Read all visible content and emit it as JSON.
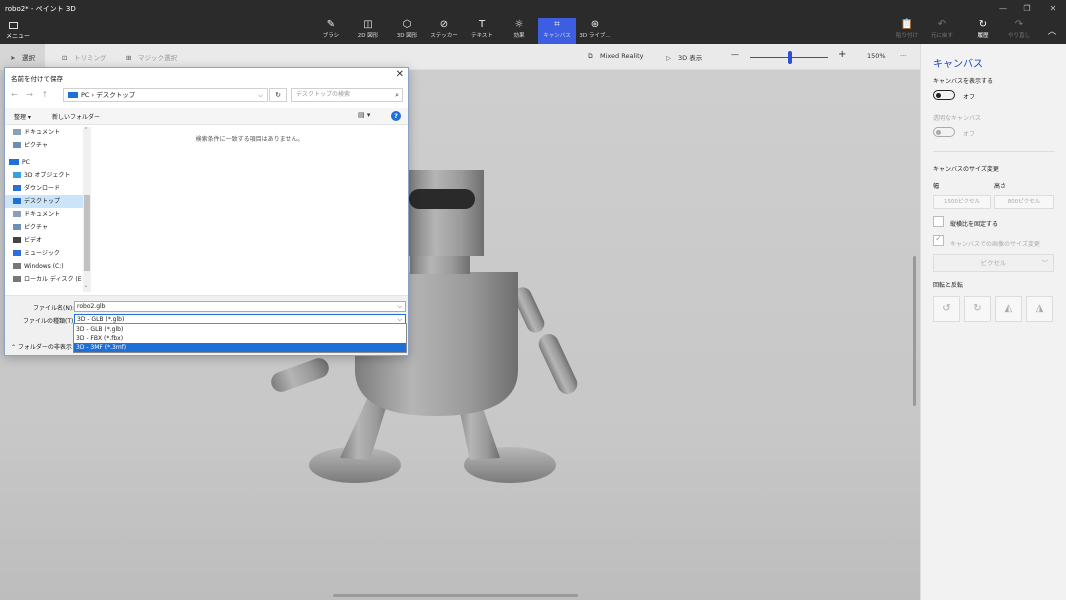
{
  "window": {
    "title": "robo2* - ペイント 3D",
    "controls": [
      "—",
      "❐",
      "✕"
    ]
  },
  "ribbon": {
    "menu_label": "メニュー",
    "tools": [
      {
        "label": "ブラシ",
        "icon": "brush-icon",
        "glyph": "✎"
      },
      {
        "label": "2D 図形",
        "icon": "2d-shapes-icon",
        "glyph": "◫"
      },
      {
        "label": "3D 図形",
        "icon": "3d-shapes-icon",
        "glyph": "⬡"
      },
      {
        "label": "ステッカー",
        "icon": "stickers-icon",
        "glyph": "⊘"
      },
      {
        "label": "テキスト",
        "icon": "text-icon",
        "glyph": "T"
      },
      {
        "label": "効果",
        "icon": "effects-icon",
        "glyph": "☼"
      },
      {
        "label": "キャンバス",
        "icon": "canvas-icon",
        "glyph": "⌗"
      },
      {
        "label": "3D ライブ...",
        "icon": "3d-library-icon",
        "glyph": "⊛"
      }
    ],
    "right_tools": [
      {
        "label": "貼り付け",
        "icon": "paste-icon",
        "glyph": "📋"
      },
      {
        "label": "元に戻す",
        "icon": "undo-icon",
        "glyph": "↶"
      },
      {
        "label": "履歴",
        "icon": "history-icon",
        "glyph": "↻"
      },
      {
        "label": "やり直し",
        "icon": "redo-icon",
        "glyph": "↷"
      }
    ],
    "collapse_glyph": "︿"
  },
  "toolbar": {
    "select_label": "選択",
    "crop_label": "トリミング",
    "magic_select_label": "マジック選択",
    "mixed_reality_label": "Mixed Reality",
    "view3d_label": "3D 表示",
    "zoom_minus": "—",
    "zoom_plus": "+",
    "zoom_level": "150%",
    "more": "···"
  },
  "panel": {
    "title": "キャンバス",
    "show_canvas_label": "キャンバスを表示する",
    "show_canvas_state": "オフ",
    "transparent_label": "透明なキャンバス",
    "transparent_state": "オフ",
    "resize_label": "キャンバスのサイズ変更",
    "width_label": "幅",
    "height_label": "高さ",
    "width_value": "1500ピクセル",
    "height_value": "800ピクセル",
    "lock_ratio_label": "縦横比を固定する",
    "resize_image_label": "キャンバスでの画像のサイズ変更",
    "unit_select": "ピクセル",
    "rotate_label": "回転と反転"
  },
  "dialog": {
    "title": "名前を付けて保存",
    "close": "✕",
    "nav_arrows": "← → ↑",
    "address": "PC  ›  デスクトップ",
    "refresh": "↻",
    "search_placeholder": "デスクトップの検索",
    "organize": "整理 ▾",
    "new_folder": "新しいフォルダー",
    "help": "?",
    "view_glyph": "▤ ▾",
    "nav_items": [
      {
        "label": "ドキュメント",
        "color": "#8aa0b8"
      },
      {
        "label": "ピクチャ",
        "color": "#6b8fb5"
      },
      {
        "label": "",
        "color": ""
      },
      {
        "label": "PC",
        "color": "#1e6fd6"
      },
      {
        "label": "3D オブジェクト",
        "color": "#38a0e0"
      },
      {
        "label": "ダウンロード",
        "color": "#2d6fd8"
      },
      {
        "label": "デスクトップ",
        "color": "#1e6fd6"
      },
      {
        "label": "ドキュメント",
        "color": "#8aa0b8"
      },
      {
        "label": "ピクチャ",
        "color": "#6b8fb5"
      },
      {
        "label": "ビデオ",
        "color": "#444"
      },
      {
        "label": "ミュージック",
        "color": "#2d6fd8"
      },
      {
        "label": "Windows (C:)",
        "color": "#777"
      },
      {
        "label": "ローカル ディスク (E",
        "color": "#777"
      }
    ],
    "empty_message": "検索条件に一致する項目はありません。",
    "filename_label": "ファイル名(N):",
    "filename_value": "robo2.glb",
    "filetype_label": "ファイルの種類(T):",
    "filetype_value": "3D - GLB (*.glb)",
    "folder_toggle": "⌃  フォルダーの非表示",
    "type_options": [
      "3D - GLB (*.glb)",
      "3D - FBX (*.fbx)",
      "3D - 3MF (*.3mf)"
    ]
  },
  "colors": {
    "accent": "#3d5ee0",
    "select_blue": "#1e6fd6",
    "ribbon_bg": "#2b2b2b"
  }
}
